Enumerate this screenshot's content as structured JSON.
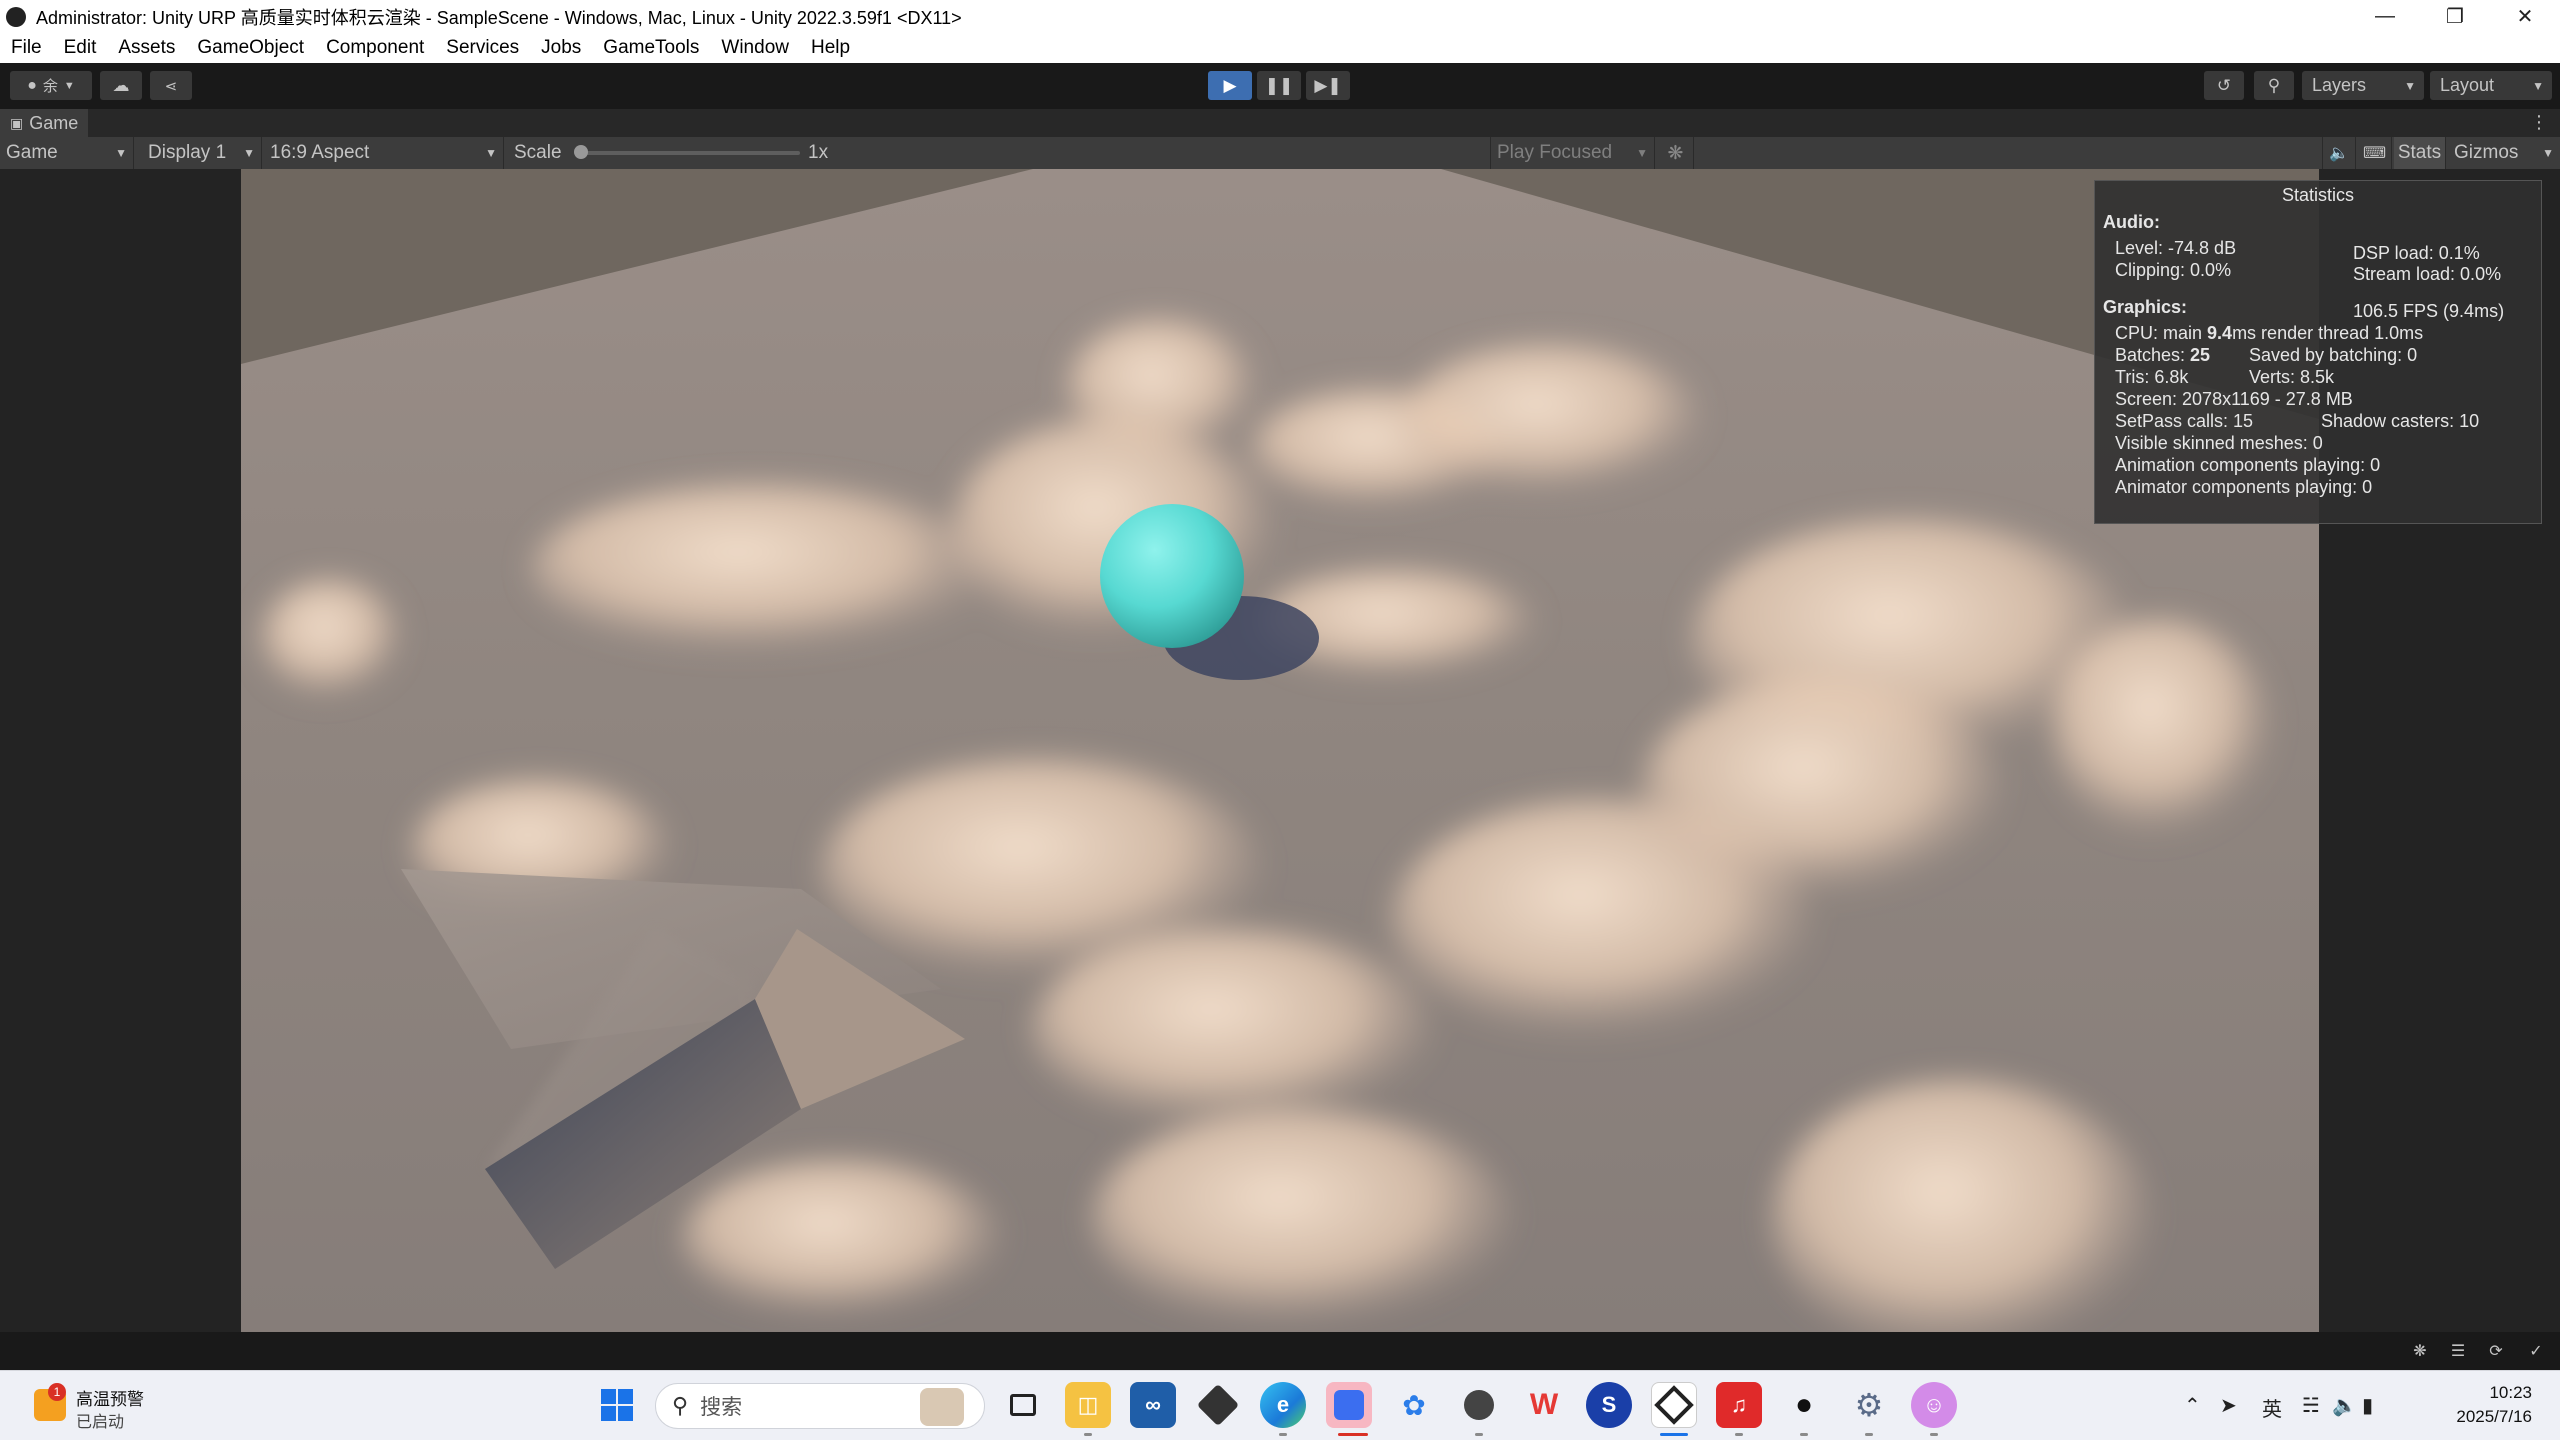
{
  "window": {
    "title": "Administrator: Unity URP 高质量实时体积云渲染 - SampleScene - Windows, Mac, Linux - Unity 2022.3.59f1 <DX11>"
  },
  "menu": [
    "File",
    "Edit",
    "Assets",
    "GameObject",
    "Component",
    "Services",
    "Jobs",
    "GameTools",
    "Window",
    "Help"
  ],
  "toolbar": {
    "account_glyph": "余",
    "layers_label": "Layers",
    "layout_label": "Layout"
  },
  "game_tab": {
    "label": "Game"
  },
  "game_bar": {
    "view_select": "Game",
    "display_select": "Display 1",
    "aspect_select": "16:9 Aspect",
    "scale_label": "Scale",
    "scale_value": "1x",
    "scale_fraction": 0.0,
    "play_mode_select": "Play Focused",
    "stats_button": "Stats",
    "gizmos_button": "Gizmos"
  },
  "stats": {
    "title": "Statistics",
    "audio_heading": "Audio:",
    "level": "Level: -74.8 dB",
    "clipping": "Clipping: 0.0%",
    "dsp_load": "DSP load: 0.1%",
    "stream_load": "Stream load: 0.0%",
    "graphics_heading": "Graphics:",
    "fps": "106.5 FPS (9.4ms)",
    "cpu_prefix": "CPU: main ",
    "cpu_main_value": "9.4",
    "cpu_suffix": "ms  render thread 1.0ms",
    "batches_prefix": "Batches: ",
    "batches_value": "25",
    "saved_by_batching": "Saved by batching: 0",
    "tris": "Tris: 6.8k",
    "verts": "Verts: 8.5k",
    "screen": "Screen: 2078x1169 - 27.8 MB",
    "setpass": "SetPass calls: 15",
    "shadow_casters": "Shadow casters: 10",
    "visible_skinned": "Visible skinned meshes: 0",
    "animation_components": "Animation components playing: 0",
    "animator_components": "Animator components playing: 0"
  },
  "taskbar": {
    "weather_title": "高温预警",
    "weather_sub": "已启动",
    "weather_badge": "1",
    "search_placeholder": "搜索",
    "input_method": "英",
    "time": "10:23",
    "date": "2025/7/16",
    "apps": [
      "start",
      "search",
      "task-view",
      "file-explorer",
      "visual-studio",
      "unity-hub",
      "edge",
      "notes",
      "photos",
      "unity-2",
      "wps",
      "browser-blue",
      "unity-editor",
      "netease-music",
      "qq",
      "settings",
      "cat-app"
    ]
  },
  "colors": {
    "sphere": "#56d9d2",
    "ground": "#8d837d",
    "cloud": "#f1d9c2",
    "play_active": "#3d6eb1"
  }
}
